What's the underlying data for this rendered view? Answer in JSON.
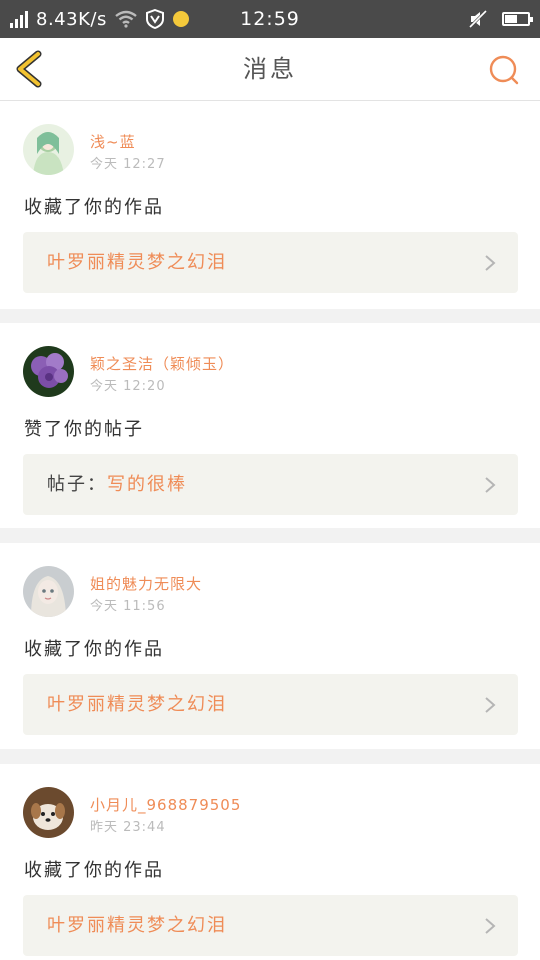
{
  "status_bar": {
    "net_speed": "8.43K/s",
    "time": "12:59",
    "battery_level": 0.55,
    "icons": [
      "signal-icon",
      "wifi-icon",
      "vpn-shield-icon",
      "notification-dot-icon",
      "mute-icon",
      "battery-icon"
    ]
  },
  "header": {
    "title": "消息",
    "back_icon": "chevron-left-icon",
    "search_icon": "search-icon"
  },
  "colors": {
    "accent_orange": "#ef8c57",
    "back_yellow": "#f2c230",
    "status_bar_bg": "#4a4a4a"
  },
  "messages": [
    {
      "user": "浅~蓝",
      "time": "今天 12:27",
      "action": "收藏了你的作品",
      "ref_prefix": "",
      "ref_text": "叶罗丽精灵梦之幻泪",
      "avatar": "anime-girl-avatar"
    },
    {
      "user": "颖之圣洁（颖倾玉）",
      "time": "今天 12:20",
      "action": "赞了你的帖子",
      "ref_prefix": "帖子：",
      "ref_text": "写的很棒",
      "avatar": "purple-roses-avatar"
    },
    {
      "user": "姐的魅力无限大",
      "time": "今天 11:56",
      "action": "收藏了你的作品",
      "ref_prefix": "",
      "ref_text": "叶罗丽精灵梦之幻泪",
      "avatar": "doll-avatar"
    },
    {
      "user": "小月儿_968879505",
      "time": "昨天 23:44",
      "action": "收藏了你的作品",
      "ref_prefix": "",
      "ref_text": "叶罗丽精灵梦之幻泪",
      "avatar": "puppy-avatar"
    }
  ]
}
